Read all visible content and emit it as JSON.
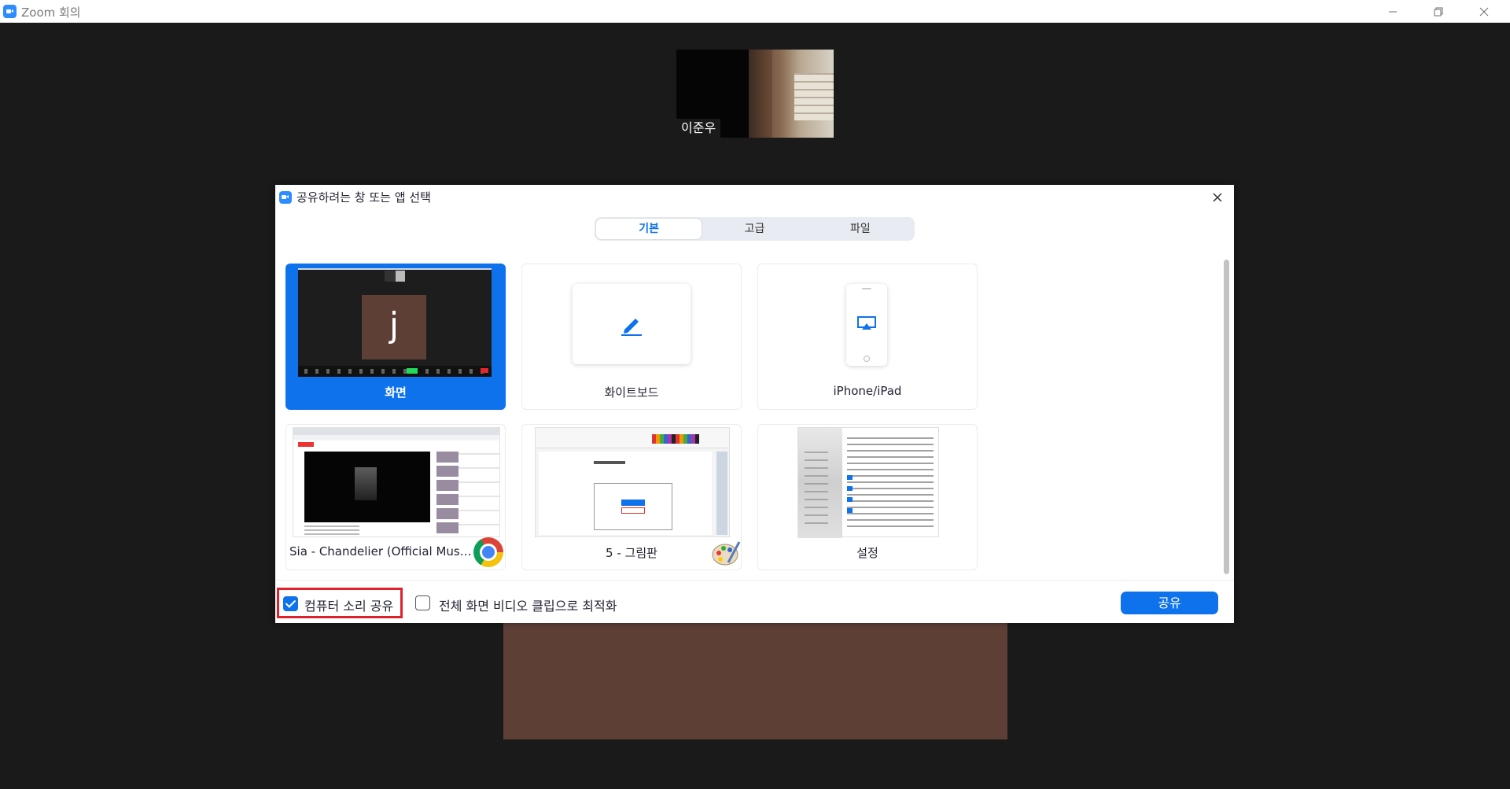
{
  "window": {
    "title": "Zoom 회의"
  },
  "meeting": {
    "participant_name": "이준우"
  },
  "dialog": {
    "title": "공유하려는 창 또는 앱 선택",
    "tabs": [
      {
        "label": "기본",
        "active": true
      },
      {
        "label": "고급",
        "active": false
      },
      {
        "label": "파일",
        "active": false
      }
    ],
    "screen_preview_avatar": "j",
    "tiles": {
      "screen": {
        "label": "화면",
        "selected": true
      },
      "whiteboard": {
        "label": "화이트보드"
      },
      "iphone": {
        "label": "iPhone/iPad"
      },
      "chrome": {
        "label": "Sia - Chandelier (Official Music Vi..."
      },
      "paint": {
        "label": "5 - 그림판"
      },
      "settings": {
        "label": "설정"
      }
    },
    "options": {
      "share_audio": {
        "label": "컴퓨터 소리 공유",
        "checked": true
      },
      "optimize_video": {
        "label": "전체 화면 비디오 클립으로 최적화",
        "checked": false
      }
    },
    "share_button": "공유"
  },
  "colors": {
    "accent": "#0e72ed",
    "highlight_border": "#e0202a",
    "avatar_bg": "#5d3f36"
  }
}
